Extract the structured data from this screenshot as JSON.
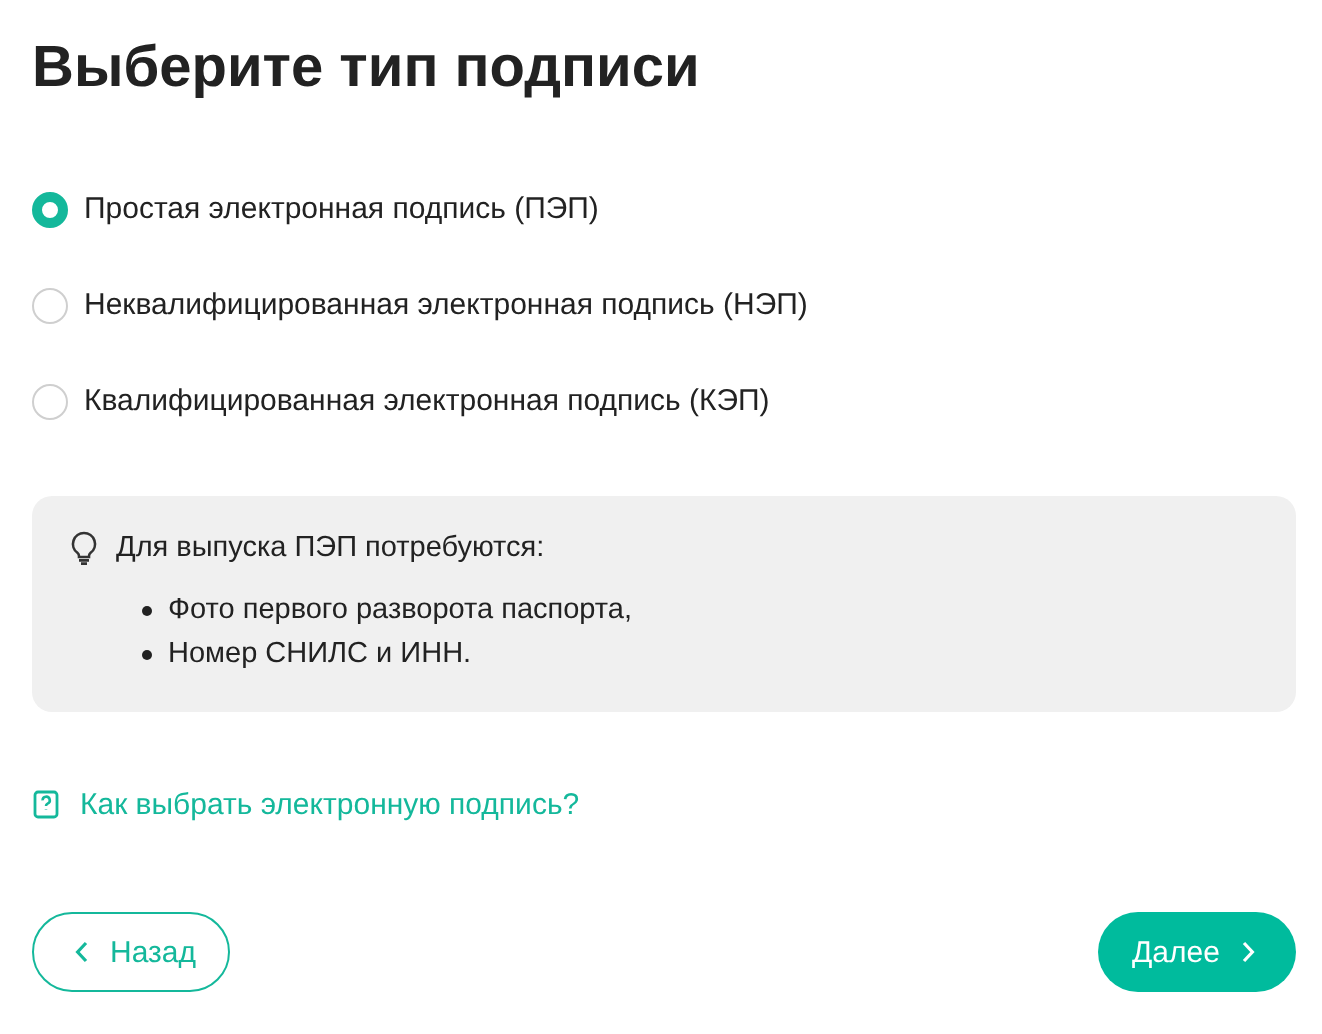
{
  "title": "Выберите тип подписи",
  "options": [
    {
      "label": "Простая электронная подпись (ПЭП)",
      "selected": true
    },
    {
      "label": "Неквалифицированная электронная подпись (НЭП)",
      "selected": false
    },
    {
      "label": "Квалифицированная электронная подпись (КЭП)",
      "selected": false
    }
  ],
  "info": {
    "heading": "Для выпуска ПЭП потребуются:",
    "items": [
      "Фото первого разворота паспорта,",
      "Номер СНИЛС и ИНН."
    ]
  },
  "help_link": "Как выбрать электронную подпись?",
  "back_button": "Назад",
  "next_button": "Далее"
}
